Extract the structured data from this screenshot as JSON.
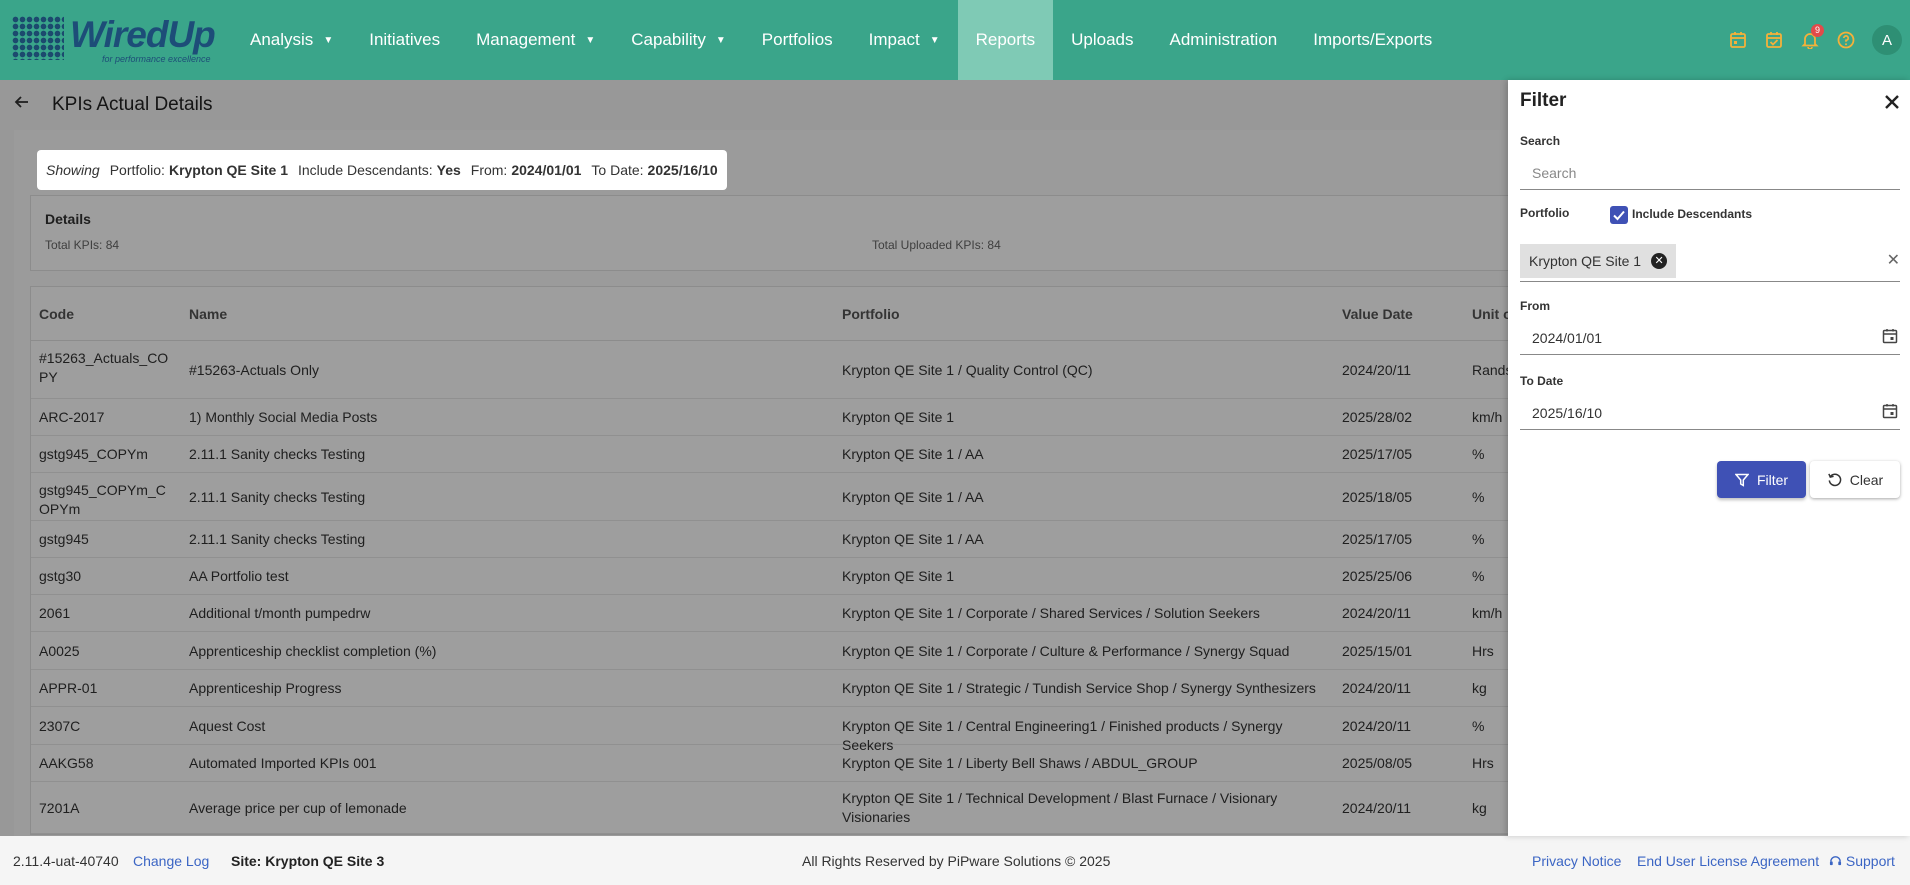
{
  "brand": {
    "name": "WiredUp",
    "tagline": "for performance excellence"
  },
  "nav": {
    "items": [
      {
        "label": "Analysis",
        "dropdown": true
      },
      {
        "label": "Initiatives",
        "dropdown": false
      },
      {
        "label": "Management",
        "dropdown": true
      },
      {
        "label": "Capability",
        "dropdown": true
      },
      {
        "label": "Portfolios",
        "dropdown": false
      },
      {
        "label": "Impact",
        "dropdown": true
      },
      {
        "label": "Reports",
        "dropdown": false,
        "active": true
      },
      {
        "label": "Uploads",
        "dropdown": false
      },
      {
        "label": "Administration",
        "dropdown": false
      },
      {
        "label": "Imports/Exports",
        "dropdown": false
      }
    ],
    "notification_count": "9",
    "avatar_initial": "A"
  },
  "page": {
    "title": "KPIs Actual Details"
  },
  "showing": {
    "label": "Showing",
    "portfolio_label": "Portfolio:",
    "portfolio_value": "Krypton QE Site 1",
    "descendants_label": "Include Descendants:",
    "descendants_value": "Yes",
    "from_label": "From:",
    "from_value": "2024/01/01",
    "to_label": "To Date:",
    "to_value": "2025/16/10"
  },
  "details": {
    "heading": "Details",
    "total_kpis": "Total KPIs: 84",
    "total_uploaded": "Total Uploaded KPIs: 84"
  },
  "table": {
    "headers": [
      "Code",
      "Name",
      "Portfolio",
      "Value Date",
      "Unit of"
    ],
    "rows": [
      {
        "code": "#15263_Actuals_COPY",
        "name": "#15263-Actuals Only",
        "portfolio": "Krypton QE Site 1 / Quality Control (QC)",
        "date": "2024/20/11",
        "unit": "Rands"
      },
      {
        "code": "ARC-2017",
        "name": "1) Monthly Social Media Posts",
        "portfolio": "Krypton QE Site 1",
        "date": "2025/28/02",
        "unit": "km/h"
      },
      {
        "code": "gstg945_COPYm",
        "name": "2.11.1 Sanity checks Testing",
        "portfolio": "Krypton QE Site 1 / AA",
        "date": "2025/17/05",
        "unit": "%"
      },
      {
        "code": "gstg945_COPYm_COPYm",
        "name": "2.11.1 Sanity checks Testing",
        "portfolio": "Krypton QE Site 1 / AA",
        "date": "2025/18/05",
        "unit": "%"
      },
      {
        "code": "gstg945",
        "name": "2.11.1 Sanity checks Testing",
        "portfolio": "Krypton QE Site 1 / AA",
        "date": "2025/17/05",
        "unit": "%"
      },
      {
        "code": "gstg30",
        "name": "AA Portfolio test",
        "portfolio": "Krypton QE Site 1",
        "date": "2025/25/06",
        "unit": "%"
      },
      {
        "code": "2061",
        "name": "Additional t/month pumpedrw",
        "portfolio": "Krypton QE Site 1 / Corporate / Shared Services / Solution Seekers",
        "date": "2024/20/11",
        "unit": "km/h"
      },
      {
        "code": "A0025",
        "name": "Apprenticeship checklist completion (%)",
        "portfolio": "Krypton QE Site 1 / Corporate / Culture & Performance / Synergy Squad",
        "date": "2025/15/01",
        "unit": "Hrs"
      },
      {
        "code": "APPR-01",
        "name": "Apprenticeship Progress",
        "portfolio": "Krypton QE Site 1 / Strategic / Tundish Service Shop / Synergy Synthesizers",
        "date": "2024/20/11",
        "unit": "kg"
      },
      {
        "code": "2307C",
        "name": "Aquest Cost",
        "portfolio": "Krypton QE Site 1 / Central Engineering1 / Finished products / Synergy Seekers",
        "date": "2024/20/11",
        "unit": "%"
      },
      {
        "code": "AAKG58",
        "name": "Automated Imported KPIs 001",
        "portfolio": "Krypton QE Site 1 / Liberty Bell Shaws / ABDUL_GROUP",
        "date": "2025/08/05",
        "unit": "Hrs"
      },
      {
        "code": "7201A",
        "name": "Average price per cup of lemonade",
        "portfolio": "Krypton QE Site 1 / Technical Development / Blast Furnace / Visionary Visionaries",
        "date": "2024/20/11",
        "unit": "kg"
      }
    ]
  },
  "filter": {
    "title": "Filter",
    "search_label": "Search",
    "search_placeholder": "Search",
    "portfolio_label": "Portfolio",
    "include_descendants_label": "Include Descendants",
    "include_descendants_checked": true,
    "portfolio_chip": "Krypton QE Site 1",
    "from_label": "From",
    "from_value": "2024/01/01",
    "to_label": "To Date",
    "to_value": "2025/16/10",
    "filter_button": "Filter",
    "clear_button": "Clear"
  },
  "footer": {
    "version": "2.11.4-uat-40740",
    "change_log": "Change Log",
    "site": "Site: Krypton QE Site 3",
    "copyright": "All Rights Reserved by PiPware Solutions © 2025",
    "privacy": "Privacy Notice",
    "eula": "End User License Agreement",
    "support": "Support"
  },
  "colors": {
    "nav_bg": "#3aa58a",
    "nav_active": "#7fcab5",
    "primary": "#3f51b5",
    "link": "#3b65c4",
    "icon_accent": "#f4b13a"
  }
}
